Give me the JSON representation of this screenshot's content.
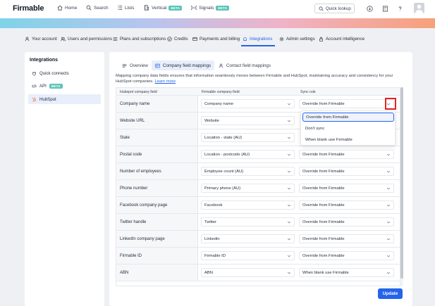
{
  "app": {
    "logo": "Firmable"
  },
  "topnav": {
    "items": [
      {
        "label": "Home",
        "icon": "home-icon"
      },
      {
        "label": "Search",
        "icon": "search-icon"
      },
      {
        "label": "Lists",
        "icon": "list-icon"
      },
      {
        "label": "Vertical",
        "icon": "building-icon",
        "badge": "BETA"
      },
      {
        "label": "Signals",
        "icon": "signal-icon",
        "badge": "BETA"
      }
    ],
    "quick_lookup": "Quick lookup",
    "right_icons": [
      "download-icon",
      "calculator-icon",
      "help-icon"
    ]
  },
  "settings_tabs": [
    {
      "label": "Your account",
      "icon": "user-icon"
    },
    {
      "label": "Users and permissions",
      "icon": "users-icon"
    },
    {
      "label": "Plans and subscriptions",
      "icon": "plans-icon"
    },
    {
      "label": "Credits",
      "icon": "credits-icon"
    },
    {
      "label": "Payments and billing",
      "icon": "card-icon"
    },
    {
      "label": "Integrations",
      "icon": "integrations-icon",
      "active": true
    },
    {
      "label": "Admin settings",
      "icon": "gear-icon"
    },
    {
      "label": "Account intelligence",
      "icon": "lock-icon"
    }
  ],
  "sidebar": {
    "title": "Integrations",
    "items": [
      {
        "label": "Quick connects",
        "icon": "plug-icon"
      },
      {
        "label": "API",
        "icon": "code-icon",
        "badge": "BETA"
      },
      {
        "label": "HubSpot",
        "icon": "hubspot-icon",
        "active": true
      }
    ]
  },
  "subtabs": [
    {
      "label": "Overview",
      "icon": "menu-icon"
    },
    {
      "label": "Company field mappings",
      "icon": "table-icon",
      "active": true
    },
    {
      "label": "Contact field mappings",
      "icon": "user-icon"
    }
  ],
  "description": {
    "text": "Mapping company data fields ensures that information seamlessly moves between Firmable and HubSpot, maintaining accuracy and consistency for your HubSpot companies.",
    "link": "Learn more"
  },
  "table": {
    "headers": [
      "Hubspot company field",
      "Firmable company field",
      "Sync rule"
    ],
    "rows": [
      {
        "hubspot": "Company name",
        "firmable": "Company name",
        "rule": "Override from Firmable"
      },
      {
        "hubspot": "Website URL",
        "firmable": "Website",
        "rule": ""
      },
      {
        "hubspot": "State",
        "firmable": "Location - state (AU)",
        "rule": ""
      },
      {
        "hubspot": "Postal code",
        "firmable": "Location - postcode (AU)",
        "rule": "Override from Firmable"
      },
      {
        "hubspot": "Number of employees",
        "firmable": "Employee count (AU)",
        "rule": "Override from Firmable"
      },
      {
        "hubspot": "Phone number",
        "firmable": "Primary phone (AU)",
        "rule": "Override from Firmable"
      },
      {
        "hubspot": "Facebook company page",
        "firmable": "Facebook",
        "rule": "Override from Firmable"
      },
      {
        "hubspot": "Twitter handle",
        "firmable": "Twitter",
        "rule": "Override from Firmable"
      },
      {
        "hubspot": "LinkedIn company page",
        "firmable": "Linkedin",
        "rule": "Override from Firmable"
      },
      {
        "hubspot": "Firmable ID",
        "firmable": "Firmable ID",
        "rule": "Override from Firmable"
      },
      {
        "hubspot": "ABN",
        "firmable": "ABN",
        "rule": "When blank use Firmable"
      }
    ]
  },
  "dropdown": {
    "options": [
      "Override from Firmable",
      "Don't sync",
      "When blank use Firmable"
    ],
    "selected": "Override from Firmable"
  },
  "actions": {
    "update": "Update"
  }
}
